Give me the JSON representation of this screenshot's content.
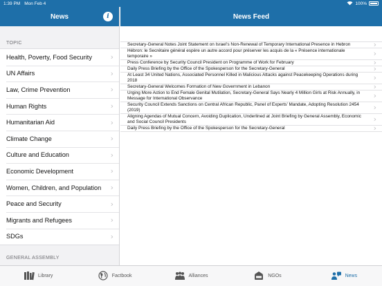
{
  "status": {
    "time": "1:39 PM",
    "date": "Mon Feb 4",
    "battery": "100%"
  },
  "left": {
    "title": "News",
    "topic_header": "TOPIC",
    "topics": [
      "Health, Poverty, Food Security",
      "UN Affairs",
      "Law, Crime Prevention",
      "Human Rights",
      "Humanitarian Aid",
      "Climate Change",
      "Culture and Education",
      "Economic Development",
      "Women, Children, and Population",
      "Peace and Security",
      "Migrants and Refugees",
      "SDGs"
    ],
    "ga_header": "GENERAL ASSEMBLY"
  },
  "right": {
    "title": "News Feed",
    "items": [
      "Secretary-General Notes Joint Statement on Israel’s Non-Renewal of Temporary International Presence in Hebron",
      "Hébron: le Secrétaire général espère un autre accord pour préserver les acquis de la « Présence internationale temporaire »",
      "Press Conference by Security Council President on Programme of Work for February",
      "Daily Press Briefing by the Office of the Spokesperson for the Secretary-General",
      "At Least 34 United Nations, Associated Personnel Killed in Malicious Attacks against Peacekeeping Operations during 2018",
      "Secretary-General Welcomes Formation of New Government in Lebanon",
      "Urging More Action to End Female Genital Mutilation, Secretary-General Says Nearly 4 Million Girls at Risk Annually, in Message for International Observance",
      "Security Council Extends Sanctions on Central African Republic, Panel of Experts’ Mandate, Adopting Resolution 2454 (2019)",
      "Aligning Agendas of Mutual Concern, Avoiding Duplication, Underlined at Joint Briefing by General Assembly, Economic and Social Council Presidents",
      "Daily Press Briefing by the Office of the Spokesperson for the Secretary-General"
    ]
  },
  "tabs": [
    {
      "label": "Library",
      "icon": "books-icon"
    },
    {
      "label": "Factbook",
      "icon": "globe-icon"
    },
    {
      "label": "Alliances",
      "icon": "people-icon"
    },
    {
      "label": "NGOs",
      "icon": "ngo-icon"
    },
    {
      "label": "News",
      "icon": "news-icon",
      "active": true
    }
  ],
  "colors": {
    "accent": "#1e6fa9"
  }
}
